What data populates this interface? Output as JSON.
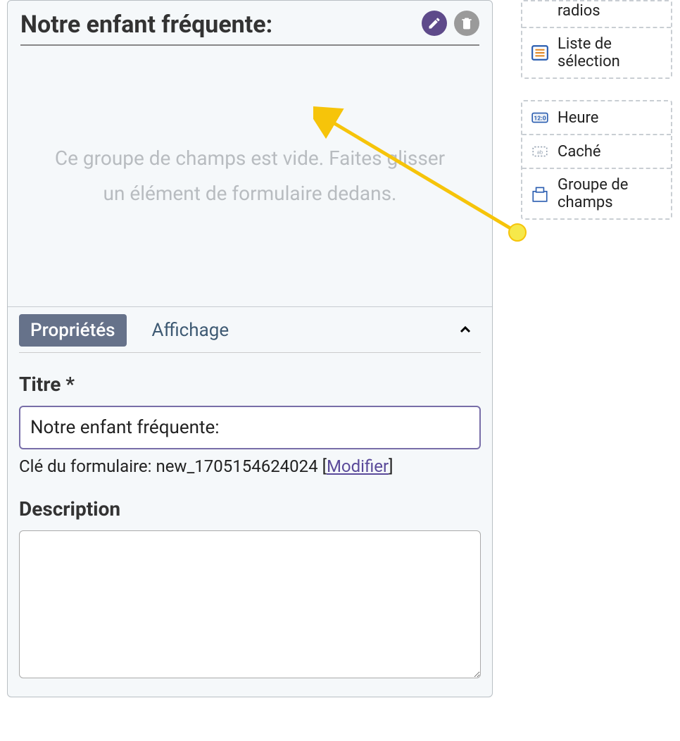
{
  "panel": {
    "title": "Notre enfant fréquente:",
    "dropzone_text": "Ce groupe de champs est vide. Faites glisser un élément de formulaire dedans."
  },
  "properties": {
    "tab_properties": "Propriétés",
    "tab_display": "Affichage",
    "title_label": "Titre *",
    "title_value": "Notre enfant fréquente:",
    "form_key_prefix": "Clé du formulaire: ",
    "form_key_value": "new_1705154624024",
    "form_key_modify": "Modifier",
    "description_label": "Description",
    "description_value": ""
  },
  "sidebar": {
    "group1": {
      "radios": "radios",
      "select_list": "Liste de sélection"
    },
    "group2": {
      "time": "Heure",
      "hidden": "Caché",
      "fieldset": "Groupe de champs"
    }
  }
}
